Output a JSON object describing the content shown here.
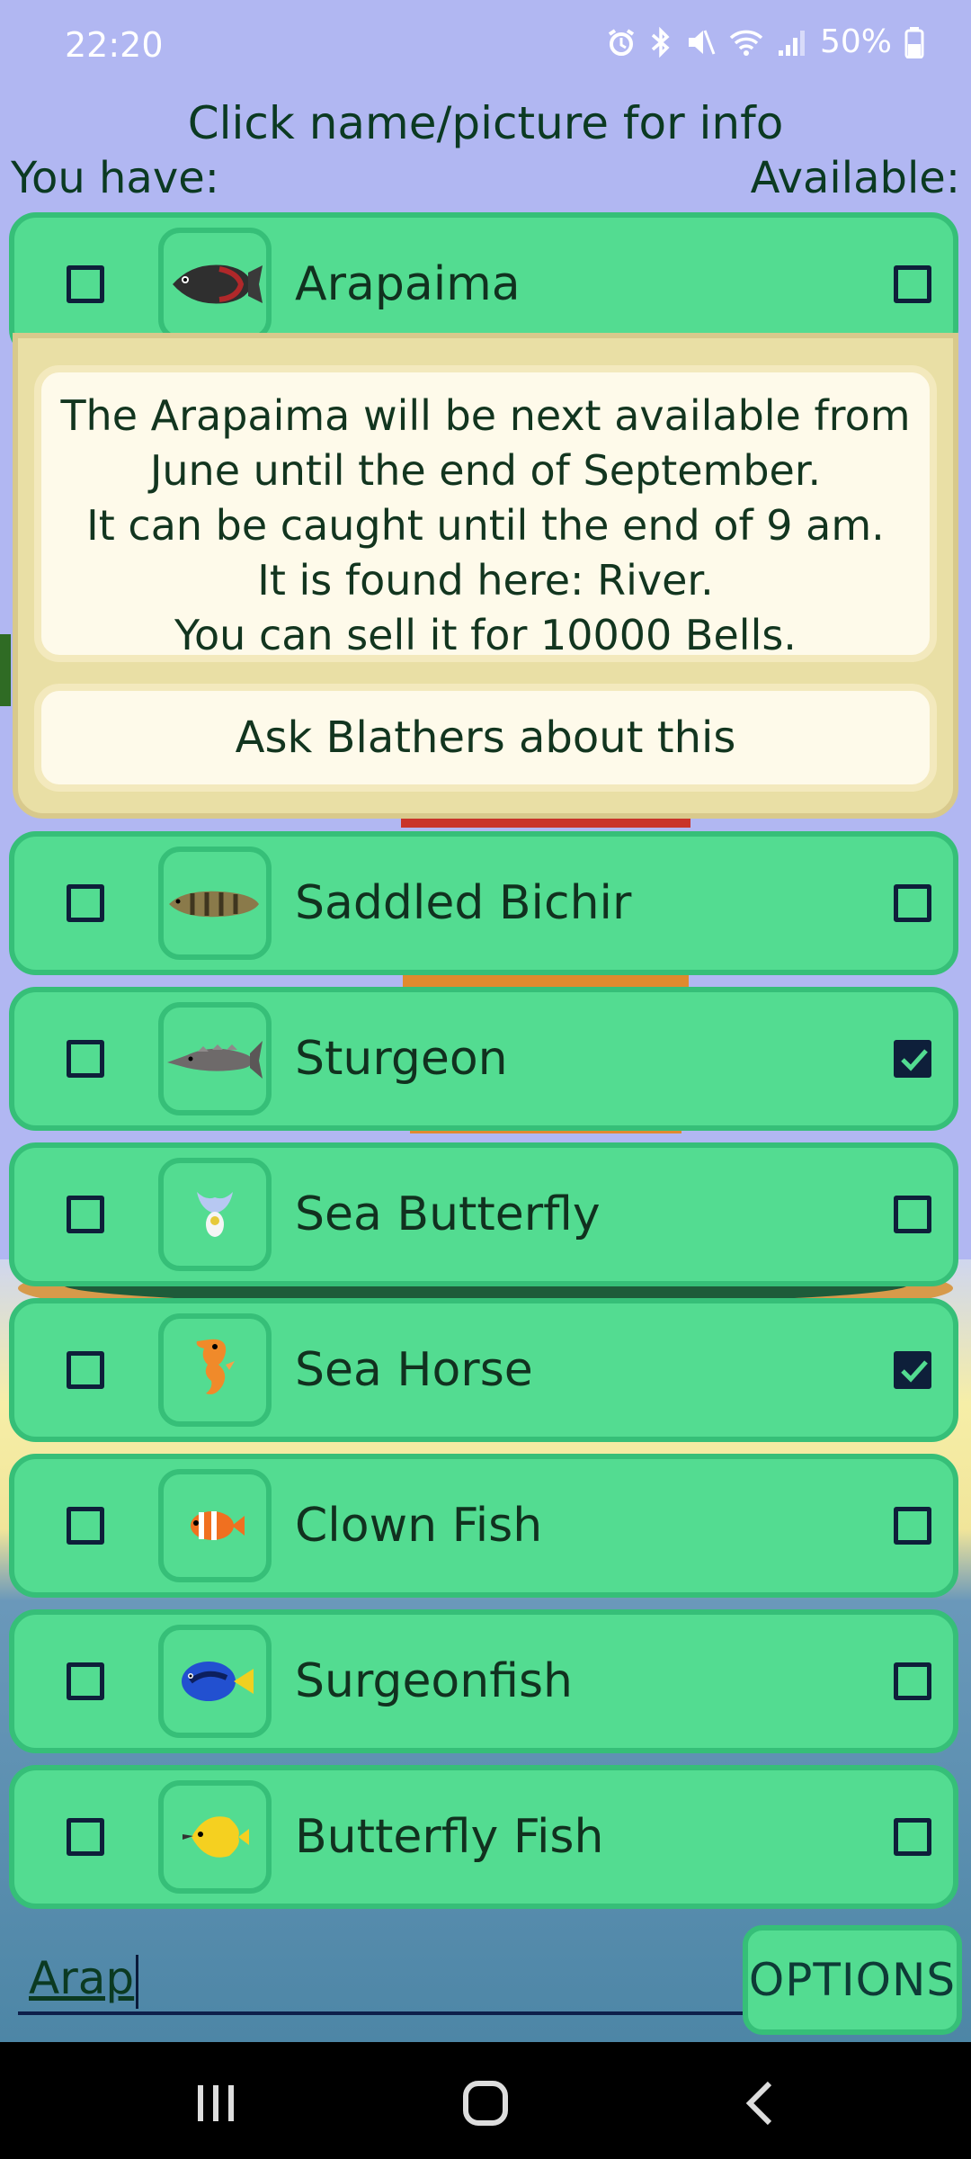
{
  "status_bar": {
    "time": "22:20",
    "battery_percent": "50%",
    "icons": [
      "alarm-icon",
      "bluetooth-icon",
      "mute-icon",
      "wifi-icon",
      "signal-icon",
      "battery-icon"
    ]
  },
  "header": {
    "instruction": "Click name/picture for info",
    "left_column_label": "You have:",
    "right_column_label": "Available:"
  },
  "expanded": {
    "name": "Arapaima",
    "have_checked": false,
    "available_checked": false,
    "info_lines": [
      "The Arapaima will be next available from",
      "June until the end of September.",
      "It can be caught until the end of 9 am.",
      "It is found here: River.",
      "You can sell it for 10000 Bells."
    ],
    "ask_button_label": "Ask Blathers about this"
  },
  "items": [
    {
      "name": "Saddled Bichir",
      "have_checked": false,
      "available_checked": false,
      "icon": "saddled-bichir-icon"
    },
    {
      "name": "Sturgeon",
      "have_checked": false,
      "available_checked": true,
      "icon": "sturgeon-icon"
    },
    {
      "name": "Sea Butterfly",
      "have_checked": false,
      "available_checked": false,
      "icon": "sea-butterfly-icon"
    },
    {
      "name": "Sea Horse",
      "have_checked": false,
      "available_checked": true,
      "icon": "sea-horse-icon"
    },
    {
      "name": "Clown Fish",
      "have_checked": false,
      "available_checked": false,
      "icon": "clown-fish-icon"
    },
    {
      "name": "Surgeonfish",
      "have_checked": false,
      "available_checked": false,
      "icon": "surgeonfish-icon"
    },
    {
      "name": "Butterfly Fish",
      "have_checked": false,
      "available_checked": false,
      "icon": "butterfly-fish-icon"
    }
  ],
  "search": {
    "value": "Arap"
  },
  "options_button": {
    "label": "OPTIONS"
  },
  "colors": {
    "row_fill": "#53dc91",
    "row_border": "#36bf78",
    "info_panel": "#e9dfa5",
    "info_box": "#fefaea",
    "text": "#0b3a22"
  },
  "nav_bar": {
    "buttons": [
      "recents-icon",
      "home-icon",
      "back-icon"
    ]
  }
}
